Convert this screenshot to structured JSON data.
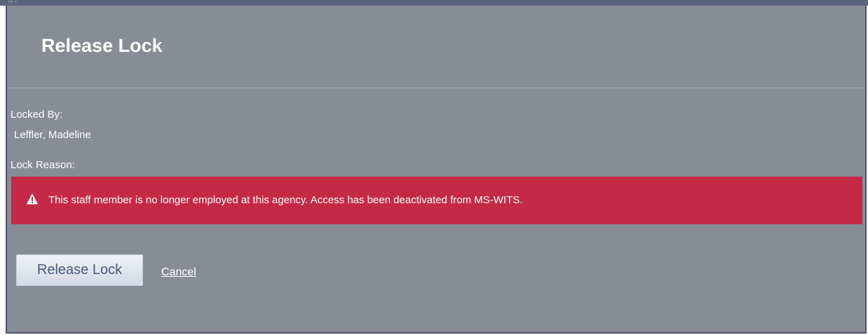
{
  "dialog": {
    "title": "Release Lock",
    "locked_by_label": "Locked By:",
    "locked_by_value": "Leffler, Madeline",
    "lock_reason_label": "Lock Reason:",
    "alert": {
      "icon": "warning-icon",
      "message": "This staff member is no longer employed at this agency. Access has been deactivated from MS-WITS.",
      "color": "#c42a46"
    },
    "release_button_label": "Release Lock",
    "cancel_link_label": "Cancel"
  },
  "colors": {
    "dialog_background": "#878c97",
    "title_text": "#ffffff",
    "button_text": "#4a5a78"
  }
}
